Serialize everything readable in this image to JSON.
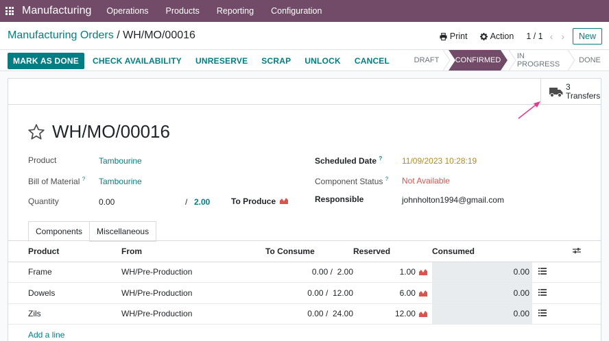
{
  "nav": {
    "app_name": "Manufacturing",
    "menus": [
      "Operations",
      "Products",
      "Reporting",
      "Configuration"
    ]
  },
  "breadcrumb": {
    "parent": "Manufacturing Orders",
    "separator": "/",
    "current": "WH/MO/00016"
  },
  "toolbar": {
    "print_label": "Print",
    "action_label": "Action",
    "pager": "1 / 1",
    "prev": "‹",
    "next": "›",
    "new_label": "New"
  },
  "actions": {
    "mark_as_done": "MARK AS DONE",
    "check_availability": "CHECK AVAILABILITY",
    "unreserve": "UNRESERVE",
    "scrap": "SCRAP",
    "unlock": "UNLOCK",
    "cancel": "CANCEL"
  },
  "states": {
    "draft": "DRAFT",
    "confirmed": "CONFIRMED",
    "in_progress": "IN PROGRESS",
    "done": "DONE"
  },
  "smart_button": {
    "count": "3",
    "label": "Transfers",
    "icon": "truck-icon"
  },
  "record": {
    "name": "WH/MO/00016",
    "product_label": "Product",
    "product_value": "Tambourine",
    "bom_label": "Bill of Material",
    "bom_value": "Tambourine",
    "quantity_label": "Quantity",
    "quantity_produced": "0.00",
    "quantity_sep": "/",
    "quantity_total": "2.00",
    "to_produce_label": "To Produce",
    "scheduled_label": "Scheduled Date",
    "scheduled_value": "11/09/2023 10:28:19",
    "component_status_label": "Component Status",
    "component_status_value": "Not Available",
    "responsible_label": "Responsible",
    "responsible_value": "johnholton1994@gmail.com",
    "help_mark": "?"
  },
  "tabs": {
    "components": "Components",
    "misc": "Miscellaneous"
  },
  "table": {
    "headers": {
      "product": "Product",
      "from": "From",
      "to_consume": "To Consume",
      "reserved": "Reserved",
      "consumed": "Consumed"
    },
    "rows": [
      {
        "product": "Frame",
        "from": "WH/Pre-Production",
        "consume_done": "0.00",
        "consume_total": "2.00",
        "reserved": "1.00",
        "consumed": "0.00"
      },
      {
        "product": "Dowels",
        "from": "WH/Pre-Production",
        "consume_done": "0.00",
        "consume_total": "12.00",
        "reserved": "6.00",
        "consumed": "0.00"
      },
      {
        "product": "Zils",
        "from": "WH/Pre-Production",
        "consume_done": "0.00",
        "consume_total": "24.00",
        "reserved": "12.00",
        "consumed": "0.00"
      }
    ],
    "add_line": "Add a line",
    "slash": "/"
  },
  "colors": {
    "brand": "#714b67",
    "accent": "#017e84",
    "danger": "#d9534f",
    "date": "#b28b1c",
    "success": "#28a745"
  }
}
